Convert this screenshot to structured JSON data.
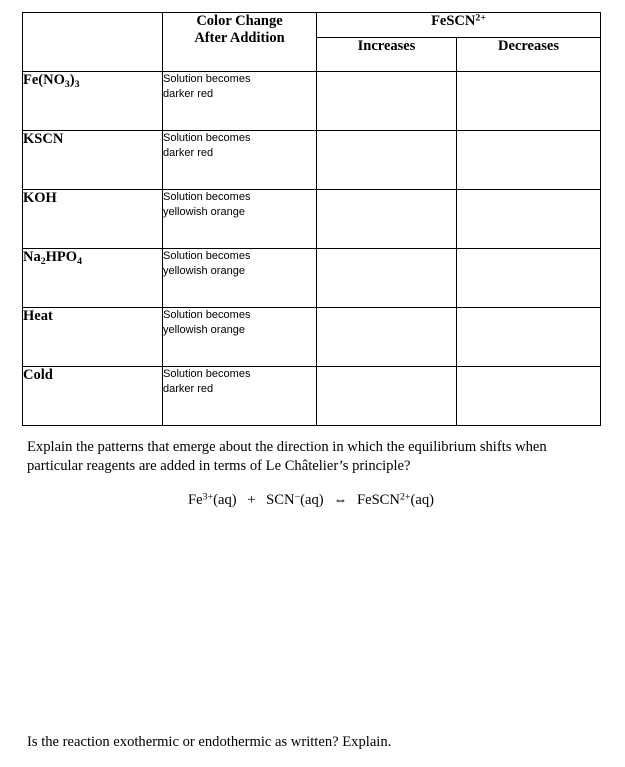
{
  "table": {
    "headers": {
      "corner": "",
      "color_change": "Color Change",
      "color_change_line2": "After Addition",
      "product_group": "FeSCN",
      "product_group_charge": "2+",
      "increases": "Increases",
      "decreases": "Decreases"
    },
    "rows": [
      {
        "reagent_html": "Fe(NO<sub>3</sub>)<sub>3</sub>",
        "reagent_text": "Fe(NO3)3",
        "color_change_line1": "Solution becomes",
        "color_change_line2": "darker red",
        "increases": "",
        "decreases": ""
      },
      {
        "reagent_html": "KSCN",
        "reagent_text": "KSCN",
        "color_change_line1": "Solution becomes",
        "color_change_line2": "darker red",
        "increases": "",
        "decreases": ""
      },
      {
        "reagent_html": "KOH",
        "reagent_text": "KOH",
        "color_change_line1": "Solution becomes",
        "color_change_line2": "yellowish orange",
        "increases": "",
        "decreases": ""
      },
      {
        "reagent_html": "Na<sub>2</sub>HPO<sub>4</sub>",
        "reagent_text": "Na2HPO4",
        "color_change_line1": "Solution becomes",
        "color_change_line2": "yellowish orange",
        "increases": "",
        "decreases": ""
      },
      {
        "reagent_html": "Heat",
        "reagent_text": "Heat",
        "color_change_line1": "Solution becomes",
        "color_change_line2": "yellowish orange",
        "increases": "",
        "decreases": ""
      },
      {
        "reagent_html": "Cold",
        "reagent_text": "Cold",
        "color_change_line1": "Solution becomes",
        "color_change_line2": "darker red",
        "increases": "",
        "decreases": ""
      }
    ]
  },
  "prose": {
    "question_line1": "Explain the patterns that emerge about the direction in which the equilibrium shifts when",
    "question_line2": "particular reagents are added in terms of Le Châtelier’s principle?",
    "final_question": "Is the reaction exothermic or endothermic as written?  Explain."
  },
  "equation": {
    "reactant1_symbol": "Fe",
    "reactant1_charge": "3+",
    "reactant1_state": "(aq)",
    "plus": "+",
    "reactant2_symbol": "SCN",
    "reactant2_charge": "−",
    "reactant2_state": "(aq)",
    "arrow": "⇔",
    "product_symbol": "FeSCN",
    "product_charge": "2+",
    "product_state": "(aq)",
    "full_text": "Fe3+(aq) + SCN-(aq) ⇔ FeSCN2+(aq)"
  },
  "colors": {
    "background": "#ffffff",
    "text": "#000000",
    "border": "#000000"
  }
}
